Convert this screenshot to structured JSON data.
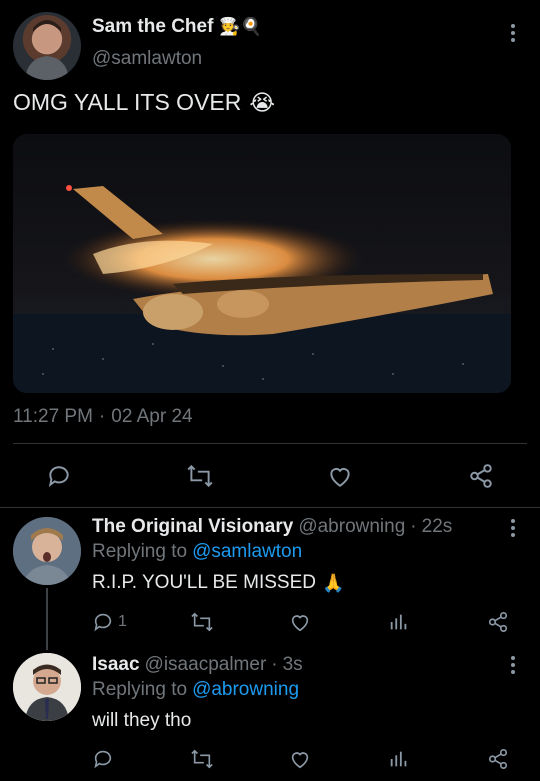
{
  "main_tweet": {
    "author_name": "Sam the Chef",
    "author_emoji": "🧑‍🍳🍳",
    "handle": "@samlawton",
    "text": "OMG YALL ITS OVER",
    "text_emoji": "😭",
    "time": "11:27 PM",
    "dot": "·",
    "date": "02 Apr 24"
  },
  "replies": [
    {
      "author_name": "The Original Visionary",
      "handle": "@abrowning",
      "dot": "·",
      "age": "22s",
      "replying_prefix": "Replying to",
      "replying_handle": "@samlawton",
      "text": "R.I.P. YOU'LL BE MISSED",
      "text_emoji": "🙏",
      "reply_count": "1"
    },
    {
      "author_name": "Isaac",
      "handle": "@isaacpalmer",
      "dot": "·",
      "age": "3s",
      "replying_prefix": "Replying to",
      "replying_handle": "@abrowning",
      "text": "will they tho",
      "reply_count": ""
    }
  ],
  "colors": {
    "background": "#000000",
    "text": "#e7e9ea",
    "muted": "#71767b",
    "link": "#1d9bf0",
    "divider": "#2f3336"
  },
  "icons": [
    "more-vertical-icon",
    "reply-icon",
    "retweet-icon",
    "like-icon",
    "share-icon",
    "analytics-icon"
  ]
}
